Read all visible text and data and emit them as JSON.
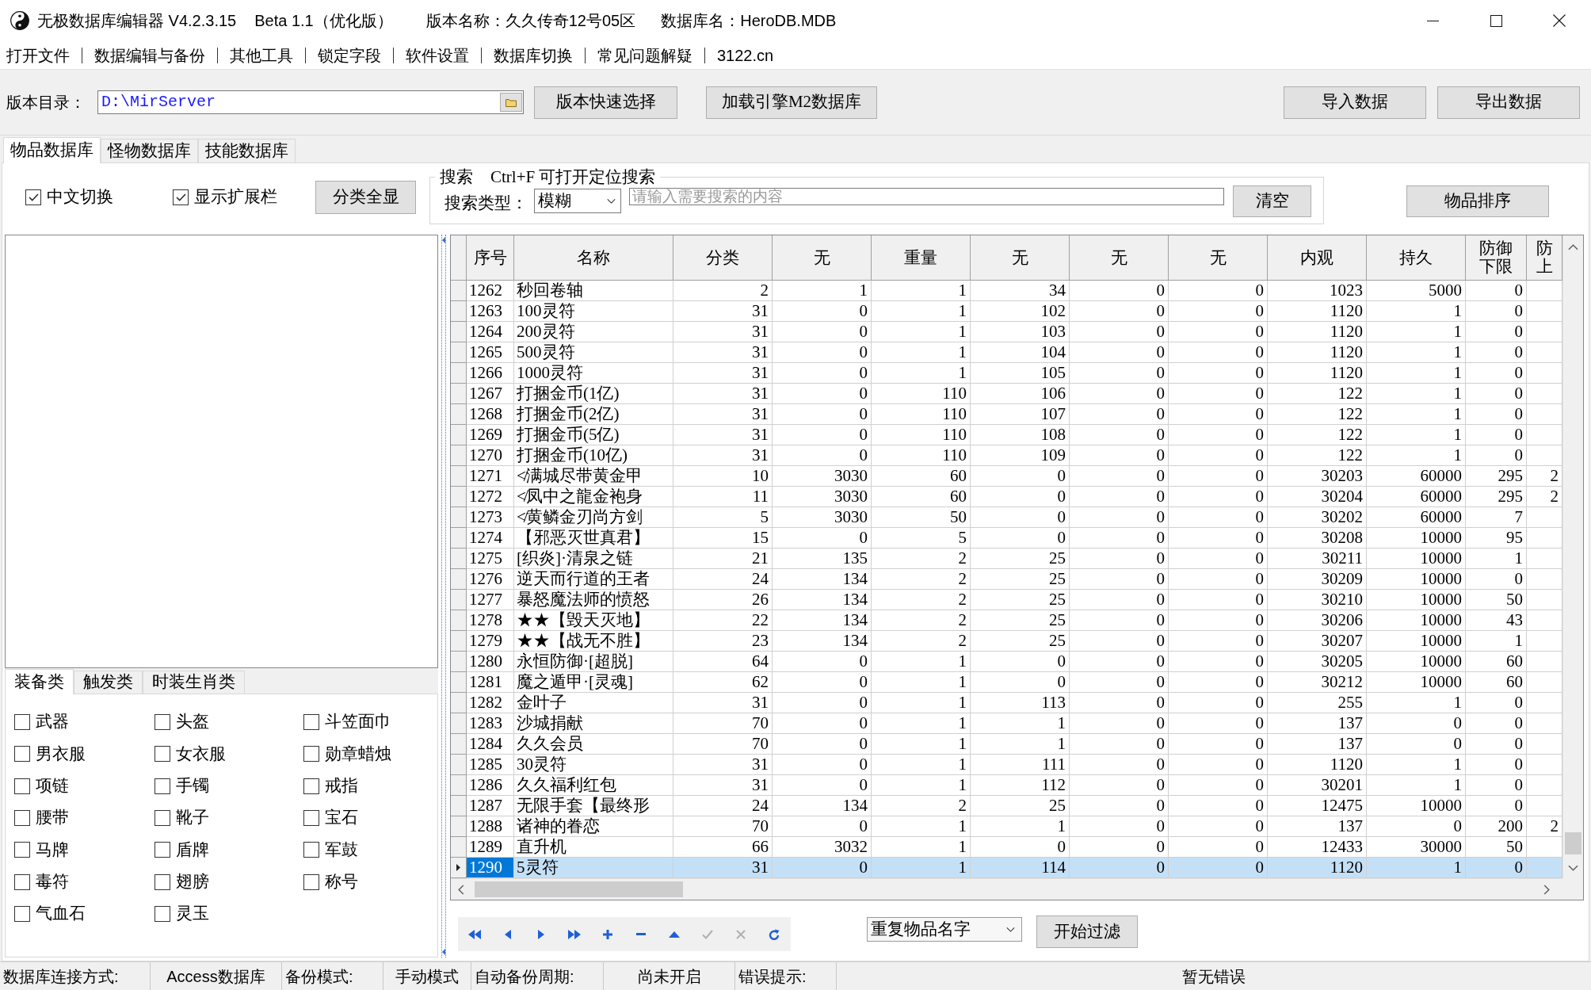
{
  "window": {
    "title_parts": [
      "无极数据库编辑器 V4.2.3.15",
      "Beta 1.1（优化版）",
      "版本名称：久久传奇12号05区",
      "数据库名：HeroDB.MDB"
    ]
  },
  "menu": [
    "打开文件",
    "数据编辑与备份",
    "其他工具",
    "锁定字段",
    "软件设置",
    "数据库切换",
    "常见问题解疑",
    "3122.cn"
  ],
  "toolbar": {
    "path_label": "版本目录：",
    "path_value": "D:\\MirServer",
    "buttons": [
      "版本快速选择",
      "加载引擎M2数据库"
    ],
    "data_buttons": [
      "导入数据",
      "导出数据"
    ]
  },
  "tabs": [
    {
      "label": "物品数据库",
      "selected": true
    },
    {
      "label": "怪物数据库",
      "selected": false
    },
    {
      "label": "技能数据库",
      "selected": false
    }
  ],
  "options": [
    {
      "label": "中文切换",
      "checked": true
    },
    {
      "label": "显示扩展栏",
      "checked": true
    }
  ],
  "show_all_button": "分类全显",
  "search": {
    "title": "搜索",
    "hint": "Ctrl+F 可打开定位搜索",
    "type_label": "搜索类型：",
    "type_value": "模糊",
    "placeholder": "请输入需要搜索的内容",
    "clear_button": "清空"
  },
  "sort_button": "物品排序",
  "category_tabs": [
    {
      "label": "装备类",
      "selected": true
    },
    {
      "label": "触发类",
      "selected": false
    },
    {
      "label": "时装生肖类",
      "selected": false
    }
  ],
  "categories": [
    {
      "label": "武器",
      "checked": false
    },
    {
      "label": "头盔",
      "checked": false
    },
    {
      "label": "斗笠面巾",
      "checked": false
    },
    {
      "label": "男衣服",
      "checked": false
    },
    {
      "label": "女衣服",
      "checked": false
    },
    {
      "label": "勋章蜡烛",
      "checked": false
    },
    {
      "label": "项链",
      "checked": false
    },
    {
      "label": "手镯",
      "checked": false
    },
    {
      "label": "戒指",
      "checked": false
    },
    {
      "label": "腰带",
      "checked": false
    },
    {
      "label": "靴子",
      "checked": false
    },
    {
      "label": "宝石",
      "checked": false
    },
    {
      "label": "马牌",
      "checked": false
    },
    {
      "label": "盾牌",
      "checked": false
    },
    {
      "label": "军鼓",
      "checked": false
    },
    {
      "label": "毒符",
      "checked": false
    },
    {
      "label": "翅膀",
      "checked": false
    },
    {
      "label": "称号",
      "checked": false
    },
    {
      "label": "气血石",
      "checked": false
    },
    {
      "label": "灵玉",
      "checked": false
    }
  ],
  "table": {
    "columns": [
      "序号",
      "名称",
      "分类",
      "无",
      "重量",
      "无",
      "无",
      "无",
      "内观",
      "持久",
      "防御下限",
      "防上"
    ],
    "rows": [
      {
        "cells": [
          "1262",
          "秒回卷轴",
          "2",
          "1",
          "1",
          "34",
          "0",
          "0",
          "1023",
          "5000",
          "0"
        ],
        "selected": false
      },
      {
        "cells": [
          "1263",
          "100灵符",
          "31",
          "0",
          "1",
          "102",
          "0",
          "0",
          "1120",
          "1",
          "0"
        ],
        "selected": false
      },
      {
        "cells": [
          "1264",
          "200灵符",
          "31",
          "0",
          "1",
          "103",
          "0",
          "0",
          "1120",
          "1",
          "0"
        ],
        "selected": false
      },
      {
        "cells": [
          "1265",
          "500灵符",
          "31",
          "0",
          "1",
          "104",
          "0",
          "0",
          "1120",
          "1",
          "0"
        ],
        "selected": false
      },
      {
        "cells": [
          "1266",
          "1000灵符",
          "31",
          "0",
          "1",
          "105",
          "0",
          "0",
          "1120",
          "1",
          "0"
        ],
        "selected": false
      },
      {
        "cells": [
          "1267",
          "打捆金币(1亿)",
          "31",
          "0",
          "110",
          "106",
          "0",
          "0",
          "122",
          "1",
          "0"
        ],
        "selected": false
      },
      {
        "cells": [
          "1268",
          "打捆金币(2亿)",
          "31",
          "0",
          "110",
          "107",
          "0",
          "0",
          "122",
          "1",
          "0"
        ],
        "selected": false
      },
      {
        "cells": [
          "1269",
          "打捆金币(5亿)",
          "31",
          "0",
          "110",
          "108",
          "0",
          "0",
          "122",
          "1",
          "0"
        ],
        "selected": false
      },
      {
        "cells": [
          "1270",
          "打捆金币(10亿)",
          "31",
          "0",
          "110",
          "109",
          "0",
          "0",
          "122",
          "1",
          "0"
        ],
        "selected": false
      },
      {
        "cells": [
          "1271",
          "≮满城尽带黄金甲",
          "10",
          "3030",
          "60",
          "0",
          "0",
          "0",
          "30203",
          "60000",
          "295",
          "2"
        ],
        "selected": false
      },
      {
        "cells": [
          "1272",
          "≮凤中之龍金袍身",
          "11",
          "3030",
          "60",
          "0",
          "0",
          "0",
          "30204",
          "60000",
          "295",
          "2"
        ],
        "selected": false
      },
      {
        "cells": [
          "1273",
          "≮黄鳞金刃尚方剑",
          "5",
          "3030",
          "50",
          "0",
          "0",
          "0",
          "30202",
          "60000",
          "7"
        ],
        "selected": false
      },
      {
        "cells": [
          "1274",
          "【邪恶灭世真君】",
          "15",
          "0",
          "5",
          "0",
          "0",
          "0",
          "30208",
          "10000",
          "95"
        ],
        "selected": false
      },
      {
        "cells": [
          "1275",
          "[织炎]·清泉之链",
          "21",
          "135",
          "2",
          "25",
          "0",
          "0",
          "30211",
          "10000",
          "1"
        ],
        "selected": false
      },
      {
        "cells": [
          "1276",
          "逆天而行道的王者",
          "24",
          "134",
          "2",
          "25",
          "0",
          "0",
          "30209",
          "10000",
          "0"
        ],
        "selected": false
      },
      {
        "cells": [
          "1277",
          "暴怒魔法师的愤怒",
          "26",
          "134",
          "2",
          "25",
          "0",
          "0",
          "30210",
          "10000",
          "50"
        ],
        "selected": false
      },
      {
        "cells": [
          "1278",
          "★★【毁天灭地】",
          "22",
          "134",
          "2",
          "25",
          "0",
          "0",
          "30206",
          "10000",
          "43"
        ],
        "selected": false
      },
      {
        "cells": [
          "1279",
          "★★【战无不胜】",
          "23",
          "134",
          "2",
          "25",
          "0",
          "0",
          "30207",
          "10000",
          "1"
        ],
        "selected": false
      },
      {
        "cells": [
          "1280",
          "永恒防御·[超脱]",
          "64",
          "0",
          "1",
          "0",
          "0",
          "0",
          "30205",
          "10000",
          "60"
        ],
        "selected": false
      },
      {
        "cells": [
          "1281",
          "魔之遁甲·[灵魂]",
          "62",
          "0",
          "1",
          "0",
          "0",
          "0",
          "30212",
          "10000",
          "60"
        ],
        "selected": false
      },
      {
        "cells": [
          "1282",
          "金叶子",
          "31",
          "0",
          "1",
          "113",
          "0",
          "0",
          "255",
          "1",
          "0"
        ],
        "selected": false
      },
      {
        "cells": [
          "1283",
          "沙城捐献",
          "70",
          "0",
          "1",
          "1",
          "0",
          "0",
          "137",
          "0",
          "0"
        ],
        "selected": false
      },
      {
        "cells": [
          "1284",
          "久久会员",
          "70",
          "0",
          "1",
          "1",
          "0",
          "0",
          "137",
          "0",
          "0"
        ],
        "selected": false
      },
      {
        "cells": [
          "1285",
          "30灵符",
          "31",
          "0",
          "1",
          "111",
          "0",
          "0",
          "1120",
          "1",
          "0"
        ],
        "selected": false
      },
      {
        "cells": [
          "1286",
          "久久福利红包",
          "31",
          "0",
          "1",
          "112",
          "0",
          "0",
          "30201",
          "1",
          "0"
        ],
        "selected": false
      },
      {
        "cells": [
          "1287",
          "无限手套【最终形",
          "24",
          "134",
          "2",
          "25",
          "0",
          "0",
          "12475",
          "10000",
          "0"
        ],
        "selected": false
      },
      {
        "cells": [
          "1288",
          "诸神的眷恋",
          "70",
          "0",
          "1",
          "1",
          "0",
          "0",
          "137",
          "0",
          "200",
          "2"
        ],
        "selected": false
      },
      {
        "cells": [
          "1289",
          "直升机",
          "66",
          "3032",
          "1",
          "0",
          "0",
          "0",
          "12433",
          "30000",
          "50"
        ],
        "selected": false
      },
      {
        "cells": [
          "1290",
          "5灵符",
          "31",
          "0",
          "1",
          "114",
          "0",
          "0",
          "1120",
          "1",
          "0"
        ],
        "selected": true
      }
    ]
  },
  "navigator": [
    {
      "kind": "first",
      "disabled": false
    },
    {
      "kind": "prior",
      "disabled": false
    },
    {
      "kind": "next",
      "disabled": false
    },
    {
      "kind": "last",
      "disabled": false
    },
    {
      "kind": "insert",
      "disabled": false
    },
    {
      "kind": "delete",
      "disabled": false
    },
    {
      "kind": "edit",
      "disabled": false
    },
    {
      "kind": "post",
      "disabled": true
    },
    {
      "kind": "cancel",
      "disabled": true
    },
    {
      "kind": "refresh",
      "disabled": false
    }
  ],
  "filter": {
    "value": "重复物品名字",
    "button": "开始过滤"
  },
  "status_bar": [
    {
      "label": "数据库连接方式:",
      "value": "Access数据库"
    },
    {
      "label": "备份模式:",
      "value": "手动模式"
    },
    {
      "label": "自动备份周期:",
      "value": "尚未开启"
    },
    {
      "label": "错误提示:",
      "value": "暂无错误"
    }
  ]
}
